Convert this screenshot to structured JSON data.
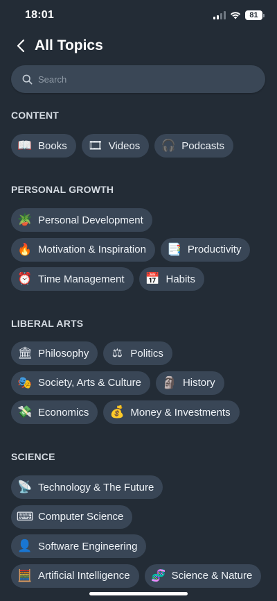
{
  "status_bar": {
    "time": "18:01",
    "battery": "81"
  },
  "header": {
    "title": "All Topics"
  },
  "search": {
    "placeholder": "Search"
  },
  "sections": [
    {
      "title": "CONTENT",
      "rows": [
        [
          {
            "icon": "📖",
            "label": "Books"
          },
          {
            "icon": "🎞",
            "label": "Videos"
          },
          {
            "icon": "🎧",
            "label": "Podcasts"
          }
        ]
      ]
    },
    {
      "title": "PERSONAL GROWTH",
      "rows": [
        [
          {
            "icon": "🪴",
            "label": "Personal Development"
          }
        ],
        [
          {
            "icon": "🔥",
            "label": "Motivation & Inspiration"
          },
          {
            "icon": "📑",
            "label": "Productivity"
          }
        ],
        [
          {
            "icon": "⏰",
            "label": "Time Management"
          },
          {
            "icon": "📅",
            "label": "Habits"
          }
        ]
      ]
    },
    {
      "title": "LIBERAL ARTS",
      "rows": [
        [
          {
            "icon": "🏛",
            "label": "Philosophy"
          },
          {
            "icon": "⚖",
            "label": "Politics"
          }
        ],
        [
          {
            "icon": "🎭",
            "label": "Society, Arts & Culture"
          },
          {
            "icon": "🗿",
            "label": "History"
          }
        ],
        [
          {
            "icon": "💸",
            "label": "Economics"
          },
          {
            "icon": "💰",
            "label": "Money & Investments"
          }
        ]
      ]
    },
    {
      "title": "SCIENCE",
      "rows": [
        [
          {
            "icon": "📡",
            "label": "Technology & The Future"
          }
        ],
        [
          {
            "icon": "⌨",
            "label": "Computer Science"
          }
        ],
        [
          {
            "icon": "👤",
            "label": "Software Engineering"
          }
        ],
        [
          {
            "icon": "🧮",
            "label": "Artificial Intelligence"
          },
          {
            "icon": "🧬",
            "label": "Science & Nature"
          }
        ]
      ]
    }
  ]
}
